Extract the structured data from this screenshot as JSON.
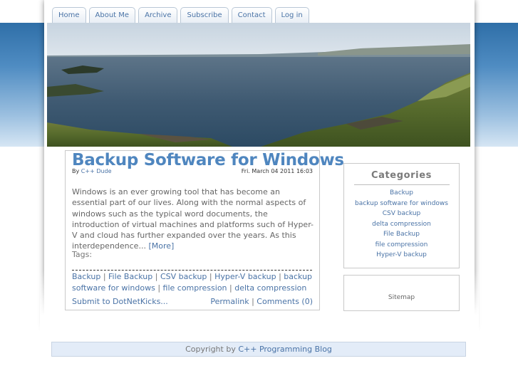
{
  "nav": {
    "tabs": [
      {
        "label": "Home"
      },
      {
        "label": "About Me"
      },
      {
        "label": "Archive"
      },
      {
        "label": "Subscribe"
      },
      {
        "label": "Contact"
      },
      {
        "label": "Log in"
      }
    ]
  },
  "post": {
    "title": "Backup Software for Windows",
    "by_prefix": "By",
    "author": "C++ Dude",
    "date": "Fri. March 04 2011 16:03",
    "excerpt": "Windows is an ever growing tool that has become an essential part of our lives. Along with the normal aspects of windows such as the typical word documents, the introduction of virtual machines and platforms such of Hyper-V and cloud has further expanded over the years.  As this interdependence...",
    "more_label": "[More]",
    "tags_label": "Tags:",
    "tags": [
      "Backup",
      "File Backup",
      "CSV backup",
      "Hyper-V backup",
      "backup software for windows",
      "file compression",
      "delta compression"
    ],
    "tag_separator": " | ",
    "submit_label": "Submit to DotNetKicks...",
    "permalink_label": "Permalink",
    "comments_label": "Comments (0)",
    "links_separator": " | "
  },
  "sidebar": {
    "categories_title": "Categories",
    "categories": [
      "Backup",
      "backup software for windows",
      "CSV backup",
      "delta compression",
      "File Backup",
      "file compression",
      "Hyper-V backup"
    ],
    "sitemap_label": "Sitemap"
  },
  "footer": {
    "prefix": "Copyright by",
    "link": "C++ Programming Blog"
  },
  "colors": {
    "link": "#4a73a6",
    "title": "#4f86bf",
    "band": "#4f8cc2",
    "footer_bg": "#e3ecf8"
  }
}
